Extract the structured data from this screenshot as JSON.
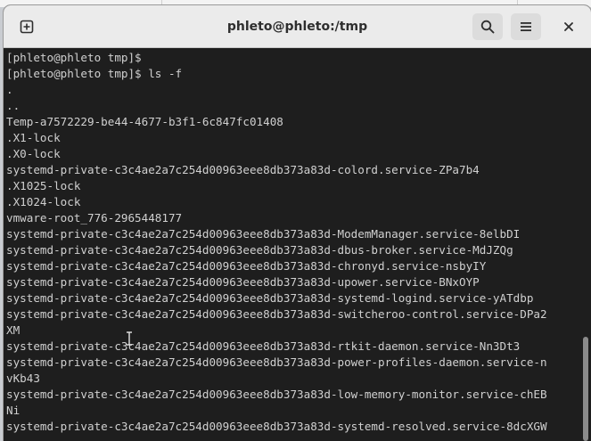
{
  "window": {
    "title": "phleto@phleto:/tmp"
  },
  "headerbar": {
    "new_tab_icon": "new-tab-icon",
    "search_icon": "search-icon",
    "menu_icon": "hamburger-menu-icon",
    "close_icon": "close-icon"
  },
  "terminal": {
    "lines": [
      "[phleto@phleto tmp]$",
      "[phleto@phleto tmp]$ ls -f",
      ".",
      "..",
      "Temp-a7572229-be44-4677-b3f1-6c847fc01408",
      ".X1-lock",
      ".X0-lock",
      "systemd-private-c3c4ae2a7c254d00963eee8db373a83d-colord.service-ZPa7b4",
      ".X1025-lock",
      ".X1024-lock",
      "vmware-root_776-2965448177",
      "systemd-private-c3c4ae2a7c254d00963eee8db373a83d-ModemManager.service-8elbDI",
      "systemd-private-c3c4ae2a7c254d00963eee8db373a83d-dbus-broker.service-MdJZQg",
      "systemd-private-c3c4ae2a7c254d00963eee8db373a83d-chronyd.service-nsbyIY",
      "systemd-private-c3c4ae2a7c254d00963eee8db373a83d-upower.service-BNxOYP",
      "systemd-private-c3c4ae2a7c254d00963eee8db373a83d-systemd-logind.service-yATdbp",
      "systemd-private-c3c4ae2a7c254d00963eee8db373a83d-switcheroo-control.service-DPa2",
      "XM",
      "systemd-private-c3c4ae2a7c254d00963eee8db373a83d-rtkit-daemon.service-Nn3Dt3",
      "systemd-private-c3c4ae2a7c254d00963eee8db373a83d-power-profiles-daemon.service-n",
      "vKb43",
      "systemd-private-c3c4ae2a7c254d00963eee8db373a83d-low-memory-monitor.service-chEB",
      "Ni",
      "systemd-private-c3c4ae2a7c254d00963eee8db373a83d-systemd-resolved.service-8dcXGW"
    ]
  },
  "colors": {
    "terminal_bg": "#1e1e1e",
    "terminal_fg": "#d0d0d0",
    "headerbar_bg": "#ebebeb"
  }
}
